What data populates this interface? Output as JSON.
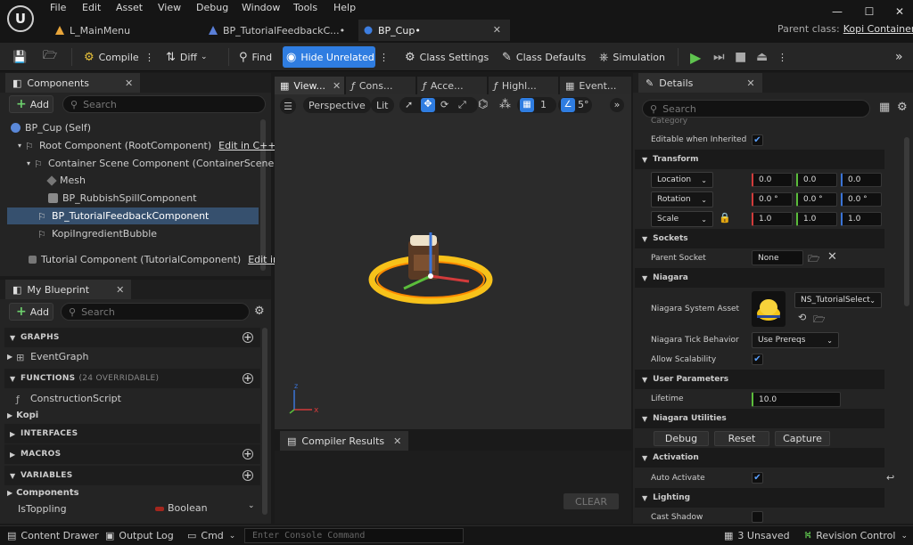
{
  "menu": [
    "File",
    "Edit",
    "Asset",
    "View",
    "Debug",
    "Window",
    "Tools",
    "Help"
  ],
  "doc_tabs": [
    {
      "label": "L_MainMenu",
      "active": false
    },
    {
      "label": "BP_TutorialFeedbackC...•",
      "active": false
    },
    {
      "label": "BP_Cup•",
      "active": true
    }
  ],
  "parent_class": {
    "label": "Parent class:",
    "value": "Kopi Container"
  },
  "toolbar": {
    "compile": "Compile",
    "diff": "Diff",
    "find": "Find",
    "hide_unrelated": "Hide Unrelated",
    "class_settings": "Class Settings",
    "class_defaults": "Class Defaults",
    "simulation": "Simulation"
  },
  "components": {
    "title": "Components",
    "add": "Add",
    "search_placeholder": "Search",
    "rows": [
      {
        "label": "BP_Cup (Self)",
        "indent": 0,
        "selected": false
      },
      {
        "label": "Root Component (RootComponent)",
        "indent": 1,
        "selected": false,
        "link": "Edit in C++"
      },
      {
        "label": "Container Scene Component (ContainerScene)",
        "indent": 2,
        "selected": false
      },
      {
        "label": "Mesh",
        "indent": 3,
        "selected": false
      },
      {
        "label": "BP_RubbishSpillComponent",
        "indent": 3,
        "selected": false
      },
      {
        "label": "BP_TutorialFeedbackComponent",
        "indent": 2,
        "selected": true
      },
      {
        "label": "KopiIngredientBubble",
        "indent": 2,
        "selected": false
      },
      {
        "label": "Tutorial Component (TutorialComponent)",
        "indent": 1,
        "selected": false,
        "link": "Edit in"
      }
    ]
  },
  "my_blueprint": {
    "title": "My Blueprint",
    "add": "Add",
    "search_placeholder": "Search",
    "graphs": "GRAPHS",
    "event_graph": "EventGraph",
    "functions": "FUNCTIONS",
    "functions_sub": "(24 OVERRIDABLE)",
    "construction_script": "ConstructionScript",
    "kopi": "Kopi",
    "interfaces": "INTERFACES",
    "macros": "MACROS",
    "variables": "VARIABLES",
    "components_cat": "Components",
    "var_name": "IsToppling",
    "var_type": "Boolean"
  },
  "viewport": {
    "tabs": [
      "View...",
      "Cons...",
      "Acce...",
      "Highl...",
      "Event..."
    ],
    "perspective": "Perspective",
    "lit": "Lit",
    "grid": "1",
    "angle": "5°"
  },
  "compiler": {
    "title": "Compiler Results",
    "clear": "CLEAR"
  },
  "details": {
    "title": "Details",
    "search_placeholder": "Search",
    "category": "Category",
    "editable_inherited": "Editable when Inherited",
    "transform": "Transform",
    "location": "Location",
    "loc": [
      "0.0",
      "0.0",
      "0.0"
    ],
    "rotation": "Rotation",
    "rot": [
      "0.0 °",
      "0.0 °",
      "0.0 °"
    ],
    "scale": "Scale",
    "scl": [
      "1.0",
      "1.0",
      "1.0"
    ],
    "sockets": "Sockets",
    "parent_socket": "Parent Socket",
    "parent_socket_val": "None",
    "niagara": "Niagara",
    "system_asset": "Niagara System Asset",
    "system_asset_val": "NS_TutorialSelect",
    "tick_behavior": "Niagara Tick Behavior",
    "tick_behavior_val": "Use Prereqs",
    "allow_scalability": "Allow Scalability",
    "user_params": "User Parameters",
    "lifetime": "Lifetime",
    "lifetime_val": "10.0",
    "utilities": "Niagara Utilities",
    "debug": "Debug",
    "reset": "Reset",
    "capture": "Capture",
    "activation": "Activation",
    "auto_activate": "Auto Activate",
    "lighting": "Lighting",
    "cast_shadow": "Cast Shadow"
  },
  "status": {
    "content_drawer": "Content Drawer",
    "output_log": "Output Log",
    "cmd": "Cmd",
    "console_placeholder": "Enter Console Command",
    "unsaved": "3 Unsaved",
    "revision": "Revision Control"
  },
  "colors": {
    "accent": "#2f7de1",
    "play": "#5fc44f",
    "selection": "#36506e"
  }
}
